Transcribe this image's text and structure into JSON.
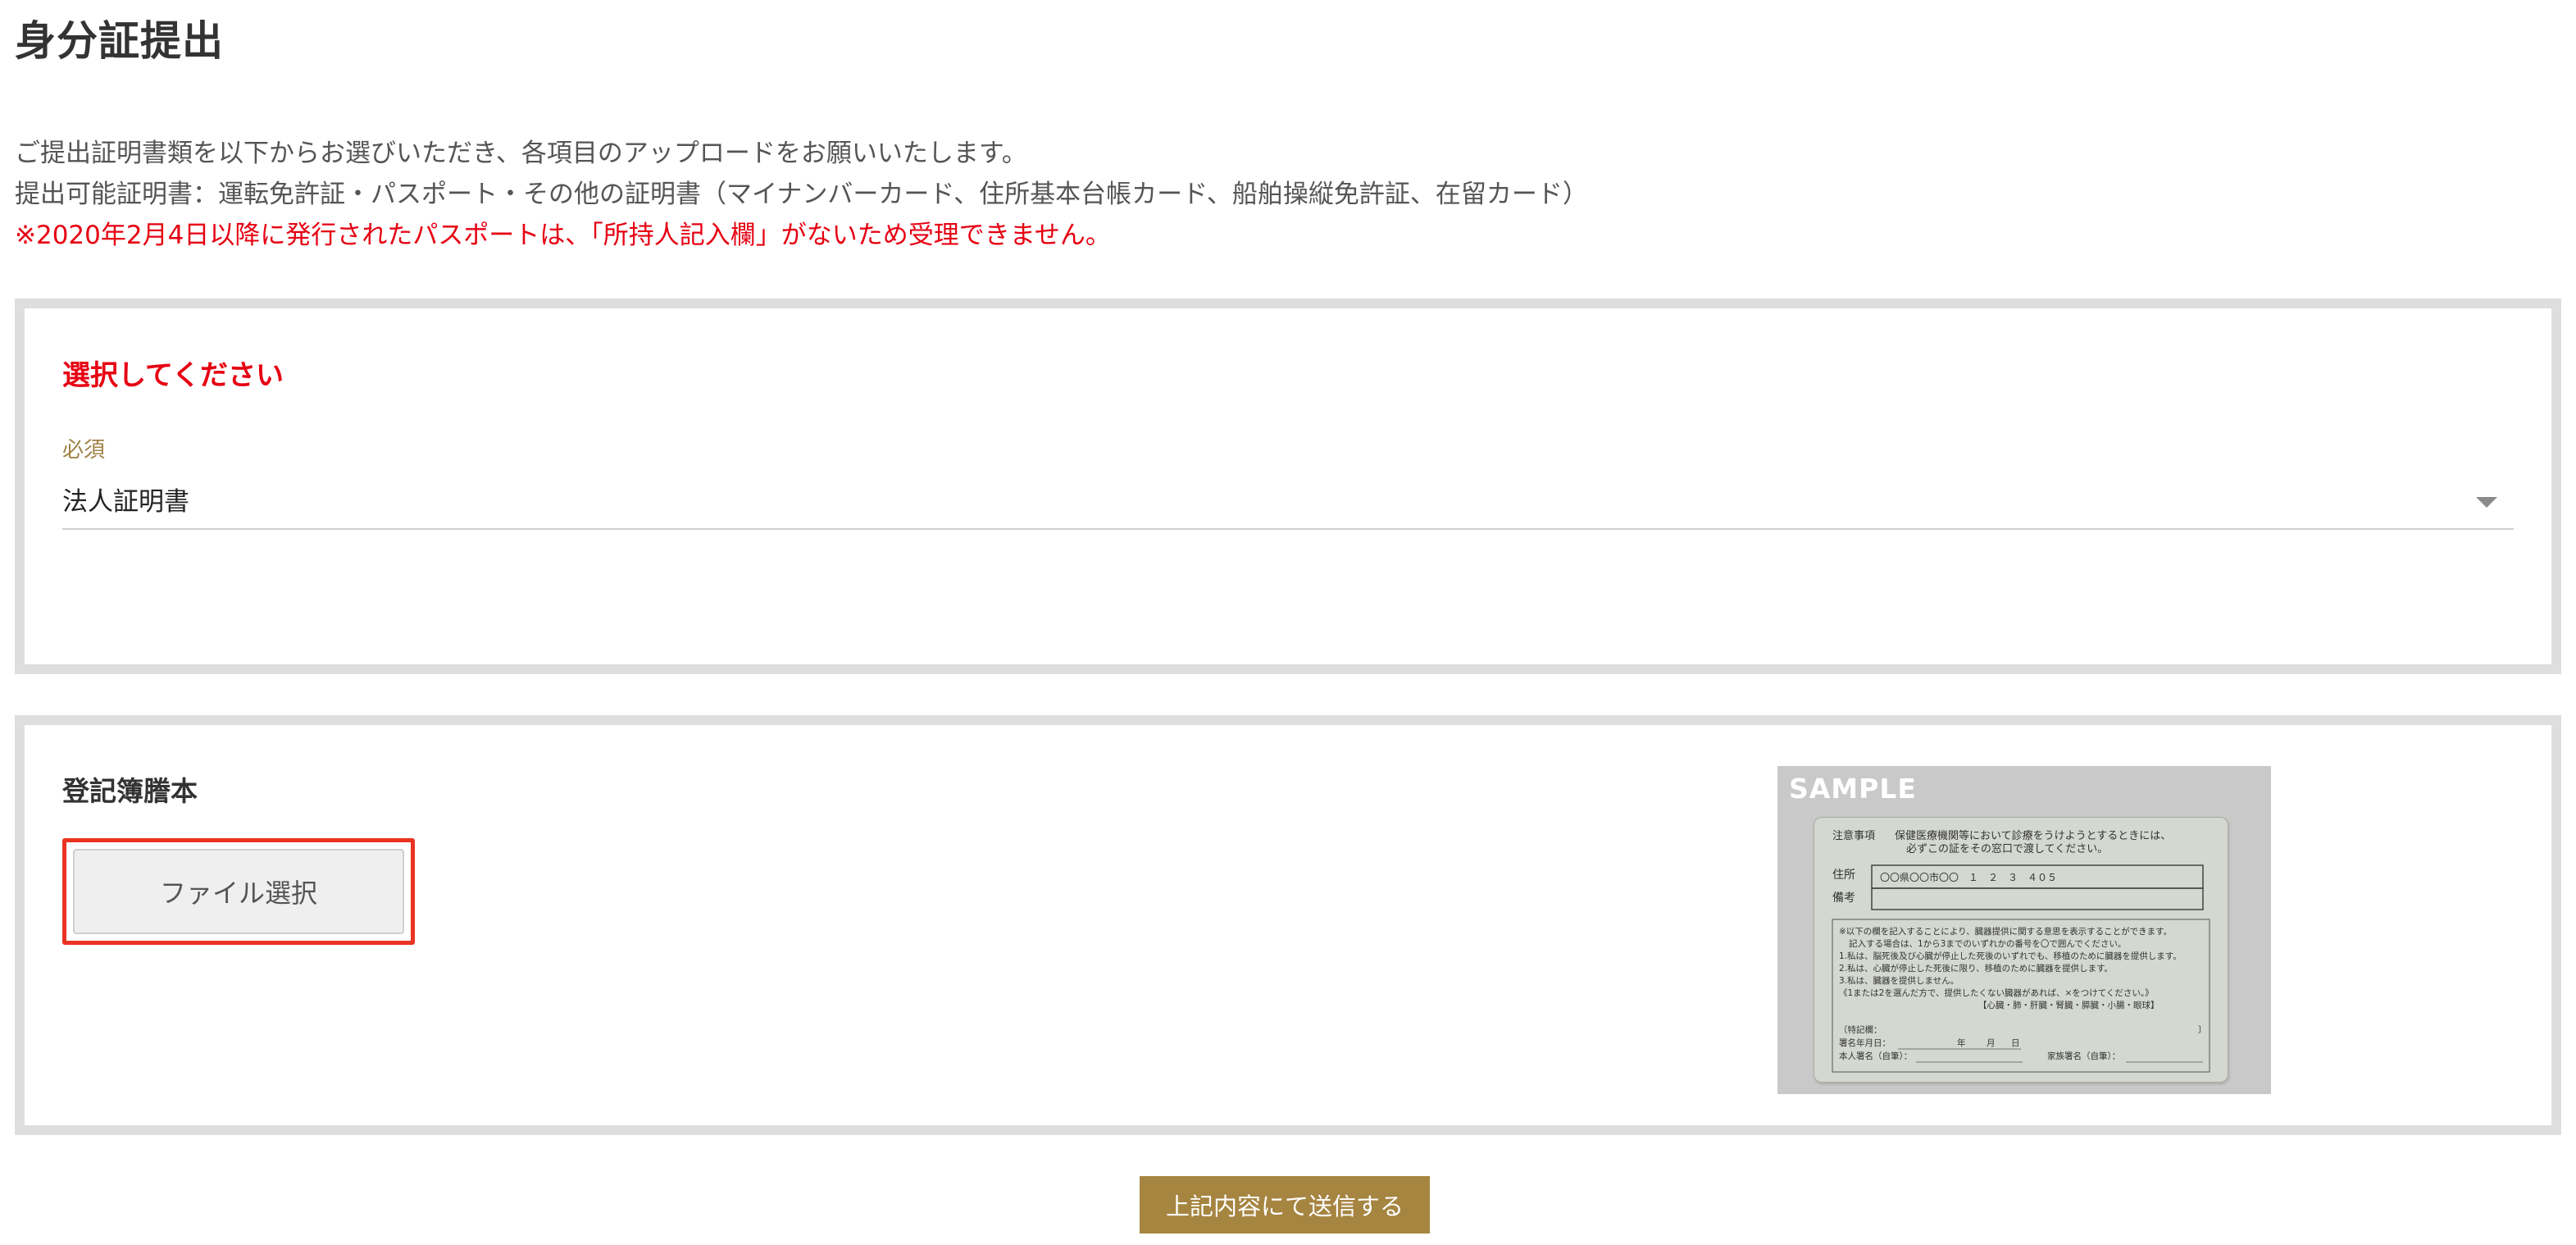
{
  "page_title": "身分証提出",
  "intro": {
    "line1": "ご提出証明書類を以下からお選びいただき、各項目のアップロードをお願いいたします。",
    "line2": "提出可能証明書：運転免許証・パスポート・その他の証明書（マイナンバーカード、住所基本台帳カード、船舶操縦免許証、在留カード）",
    "warning": "※2020年2月4日以降に発行されたパスポートは、「所持人記入欄」がないため受理できません。"
  },
  "select_panel": {
    "heading": "選択してください",
    "required_label": "必須",
    "selected_value": "法人証明書"
  },
  "upload_panel": {
    "document_title": "登記簿謄本",
    "file_button_label": "ファイル選択",
    "sample": {
      "label": "SAMPLE",
      "card": {
        "notice_heading": "注意事項",
        "notice_text_1": "保健医療機関等において診療をうけようとするときには、",
        "notice_text_2": "必ずこの証をその窓口で渡してください。",
        "address_label": "住所",
        "address_value": "〇〇県〇〇市〇〇　１　２　３　４０５",
        "remarks_label": "備考",
        "box_line_1": "※以下の欄を記入することにより、臓器提供に関する意思を表示することができます。",
        "box_line_2": "記入する場合は、1から3までのいずれかの番号を〇で囲んでください。",
        "box_line_3": "1.私は、脳死後及び心臓が停止した死後のいずれでも、移植のために臓器を提供します。",
        "box_line_4": "2.私は、心臓が停止した死後に限り、移植のために臓器を提供します。",
        "box_line_5": "3.私は、臓器を提供しません。",
        "box_line_6": "《1または2を選んだ方で、提供したくない臓器があれば、×をつけてください。》",
        "box_line_7": "【心臓・肺・肝臓・腎臓・膵臓・小腸・眼球】",
        "special_note": "〔特記欄：",
        "special_note_end": "〕",
        "sign_date": "署名年月日：",
        "year": "年",
        "month": "月",
        "day": "日",
        "self_sign": "本人署名（自筆）：",
        "family_sign": "家族署名（自筆）："
      }
    }
  },
  "submit_label": "上記内容にて送信する",
  "colors": {
    "warning_red": "#e60012",
    "accent_gold": "#a68541",
    "required_gold": "#a08347",
    "highlight_red": "#ea3323",
    "panel_border": "#dedede"
  }
}
